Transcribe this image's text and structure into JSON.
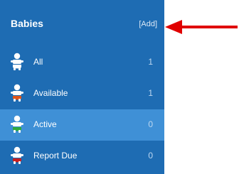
{
  "sidebar": {
    "title": "Babies",
    "add_label": "[Add]",
    "items": [
      {
        "label": "All",
        "count": "1",
        "diaper_color": "#ffffff"
      },
      {
        "label": "Available",
        "count": "1",
        "diaper_color": "#e0561b"
      },
      {
        "label": "Active",
        "count": "0",
        "diaper_color": "#2eaa3f"
      },
      {
        "label": "Report Due",
        "count": "0",
        "diaper_color": "#c81f1f"
      }
    ],
    "active_index": 2
  },
  "colors": {
    "sidebar_bg": "#1e6cb3",
    "active_bg": "#3f90d6",
    "arrow": "#e00000"
  }
}
